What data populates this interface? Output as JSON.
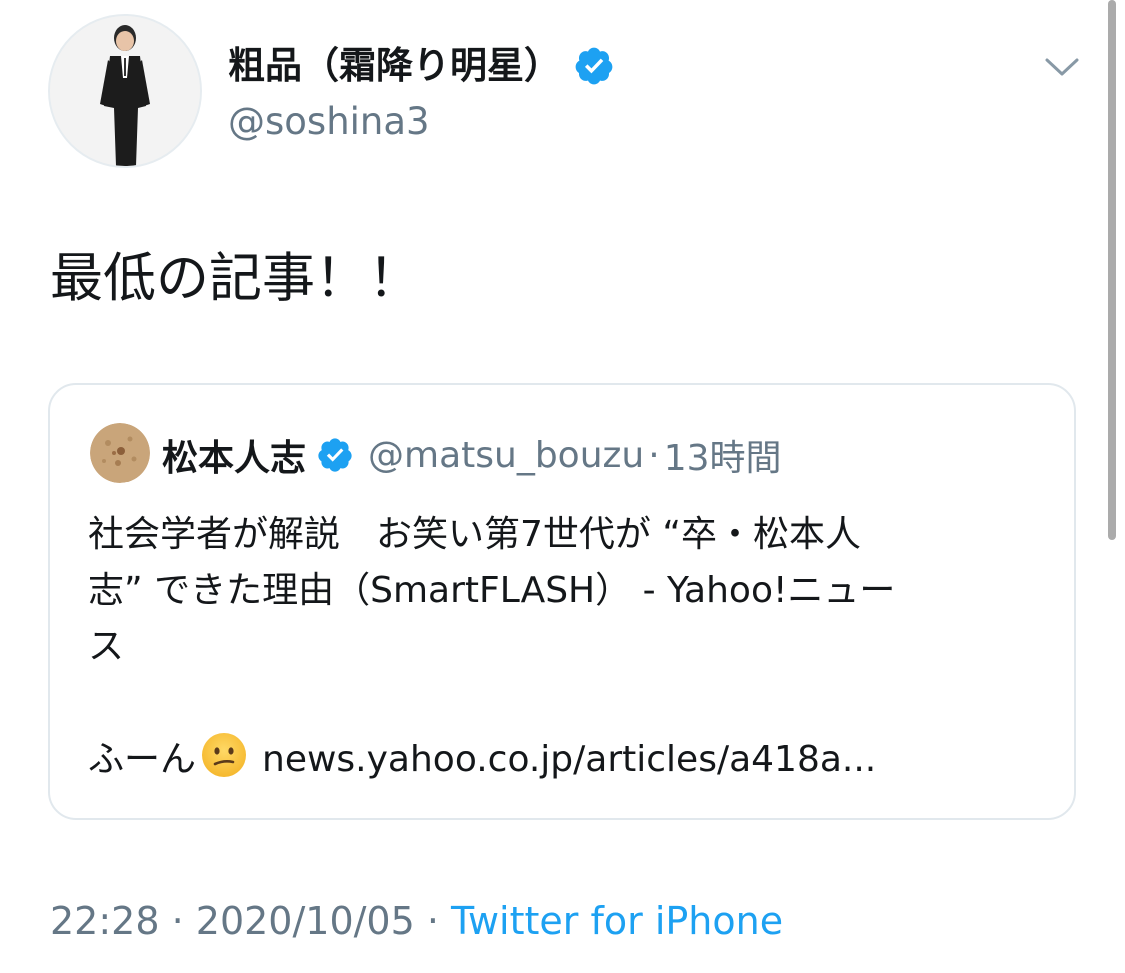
{
  "author": {
    "display_name": "粗品（霜降り明星）",
    "handle": "@soshina3",
    "verified_icon": "verified-badge-icon",
    "avatar_icon": "profile-photo-avatar"
  },
  "menu": {
    "icon": "chevron-down-icon"
  },
  "tweet": {
    "text": "最低の記事！！"
  },
  "quoted_tweet": {
    "avatar_icon": "profile-photo-avatar",
    "display_name": "松本人志",
    "handle": "@matsu_bouzu",
    "separator": "·",
    "time_ago": "13時間",
    "text_lines": [
      "社会学者が解説　お笑い第7世代が “卒・松本人",
      "志” できた理由（SmartFLASH） - Yahoo!ニュー",
      "ス"
    ],
    "final_line_prefix": "ふーん",
    "emoji_icon": "confused-face-emoji",
    "link_text": "news.yahoo.co.jp/articles/a418a..."
  },
  "footer": {
    "time": "22:28",
    "separator": " · ",
    "date": "2020/10/05",
    "source": "Twitter for iPhone"
  },
  "colors": {
    "text_primary": "#14171a",
    "text_secondary": "#657786",
    "link_blue": "#1da1f2",
    "verified_blue": "#1da1f2",
    "card_border": "#e1e8ed"
  }
}
